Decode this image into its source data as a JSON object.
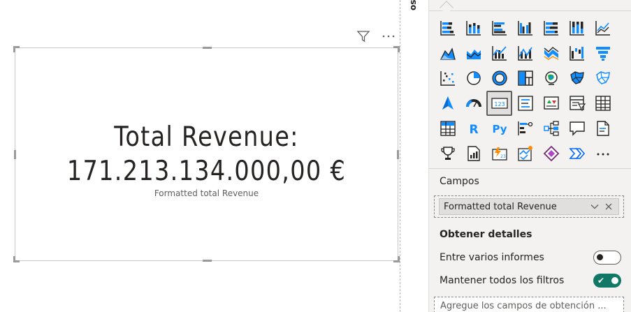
{
  "canvas": {
    "card": {
      "value": "Total Revenue:\n171.213.134.000,00 €",
      "label": "Formatted total Revenue"
    },
    "header_icons": [
      "filter-icon",
      "more-options-icon"
    ]
  },
  "strip": {
    "label": "os"
  },
  "pane": {
    "visualizations": [
      "stacked-bar-chart",
      "stacked-column-chart",
      "clustered-bar-chart",
      "clustered-column-chart",
      "100-stacked-bar-chart",
      "100-stacked-column-chart",
      "line-chart",
      "area-chart",
      "stacked-area-chart",
      "line-and-stacked-column-chart",
      "line-and-clustered-column-chart",
      "ribbon-chart",
      "waterfall-chart",
      "funnel-chart",
      "scatter-chart",
      "pie-chart",
      "donut-chart",
      "treemap",
      "map",
      "filled-map",
      "shape-map",
      "azure-map",
      "gauge",
      "card",
      "multi-row-card",
      "kpi",
      "slicer",
      "table",
      "matrix",
      "r-script-visual",
      "python-visual",
      "key-influencers",
      "decomposition-tree",
      "qna",
      "smart-narrative",
      "metrics",
      "paginated-report",
      "power-apps",
      "power-automate",
      "power-apps-alt",
      "power-automate-alt",
      "more-visuals"
    ],
    "selected_visual": "card",
    "campos_title": "Campos",
    "field": {
      "name": "Formatted total Revenue"
    },
    "drillthrough": {
      "title": "Obtener detalles",
      "cross_report": {
        "label": "Entre varios informes",
        "state": "off"
      },
      "keep_filters": {
        "label": "Mantener todos los filtros",
        "state": "on"
      },
      "well_placeholder": "Agregue los campos de obtención ..."
    }
  }
}
